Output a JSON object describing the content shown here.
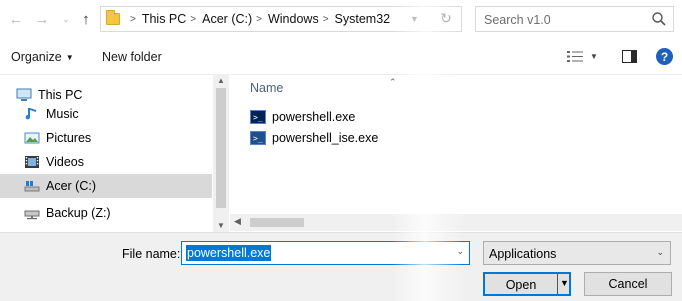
{
  "nav_buttons": {
    "back_icon": "arrow-left-icon",
    "forward_icon": "arrow-right-icon",
    "recent_icon": "chevron-down-icon",
    "up_icon": "arrow-up-icon"
  },
  "address": {
    "crumbs": [
      "This PC",
      "Acer (C:)",
      "Windows",
      "System32"
    ],
    "separator": ">"
  },
  "search": {
    "placeholder": "Search v1.0"
  },
  "toolbar": {
    "organize_label": "Organize",
    "new_folder_label": "New folder",
    "help_label": "?"
  },
  "navpane": {
    "items": [
      {
        "label": "This PC",
        "icon": "computer-icon"
      },
      {
        "label": "Music",
        "icon": "music-note-icon"
      },
      {
        "label": "Pictures",
        "icon": "pictures-icon"
      },
      {
        "label": "Videos",
        "icon": "videos-icon"
      },
      {
        "label": "Acer (C:)",
        "icon": "drive-icon",
        "selected": true
      },
      {
        "label": "Backup (Z:)",
        "icon": "network-drive-icon"
      }
    ]
  },
  "filelist": {
    "column_name": "Name",
    "files": [
      {
        "name": "powershell.exe",
        "icon": "powershell-icon"
      },
      {
        "name": "powershell_ise.exe",
        "icon": "powershell-ise-icon"
      }
    ]
  },
  "bottom": {
    "file_name_label": "File name:",
    "file_name_value": "powershell.exe",
    "file_type_value": "Applications",
    "open_label": "Open",
    "cancel_label": "Cancel"
  },
  "colors": {
    "accent": "#0078d7",
    "selection_gray": "#d9d9d9",
    "column_header": "#4c607a",
    "powershell_blue": "#012456"
  }
}
